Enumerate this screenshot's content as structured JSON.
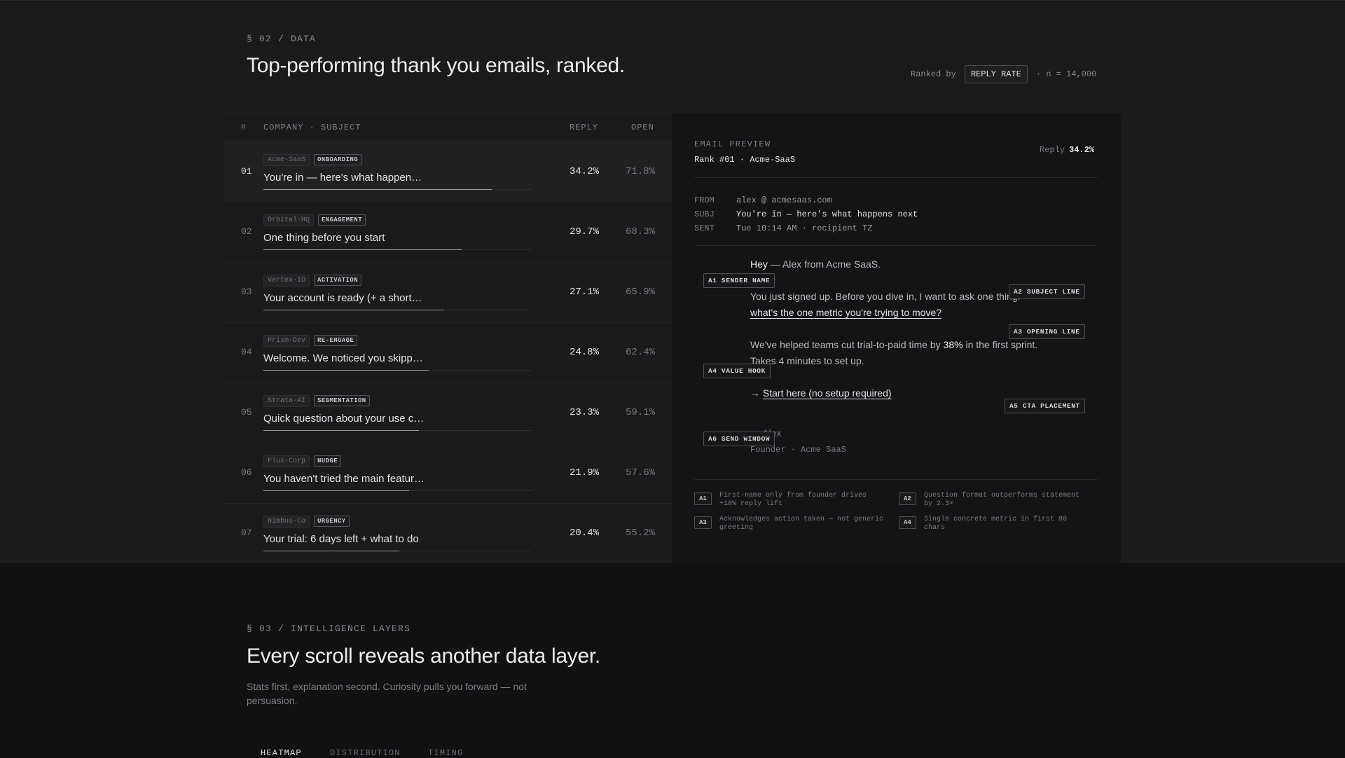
{
  "section02": {
    "eyebrow": "§ 02 / DATA",
    "title": "Top-performing thank you emails, ranked.",
    "ranked_by_label": "Ranked by",
    "ranked_by_value": "REPLY RATE",
    "n_label": "· n = 14,000"
  },
  "table": {
    "headers": {
      "rank": "#",
      "company_subject": "COMPANY · SUBJECT",
      "reply": "REPLY",
      "open": "OPEN"
    },
    "rows": [
      {
        "rank": "01",
        "company": "Acme-SaaS",
        "tag": "ONBOARDING",
        "subject": "You're in — here's what happen…",
        "reply": "34.2%",
        "open": "71.8%",
        "reply_value": 34.2
      },
      {
        "rank": "02",
        "company": "Orbital-HQ",
        "tag": "ENGAGEMENT",
        "subject": "One thing before you start",
        "reply": "29.7%",
        "open": "68.3%",
        "reply_value": 29.7
      },
      {
        "rank": "03",
        "company": "Vertex-IO",
        "tag": "ACTIVATION",
        "subject": "Your account is ready (+ a short…",
        "reply": "27.1%",
        "open": "65.9%",
        "reply_value": 27.1
      },
      {
        "rank": "04",
        "company": "Prism-Dev",
        "tag": "RE-ENGAGE",
        "subject": "Welcome. We noticed you skipp…",
        "reply": "24.8%",
        "open": "62.4%",
        "reply_value": 24.8
      },
      {
        "rank": "05",
        "company": "Strata-AI",
        "tag": "SEGMENTATION",
        "subject": "Quick question about your use c…",
        "reply": "23.3%",
        "open": "59.1%",
        "reply_value": 23.3
      },
      {
        "rank": "06",
        "company": "Flux-Corp",
        "tag": "NUDGE",
        "subject": "You haven't tried the main featur…",
        "reply": "21.9%",
        "open": "57.6%",
        "reply_value": 21.9
      },
      {
        "rank": "07",
        "company": "Nimbus-Co",
        "tag": "URGENCY",
        "subject": "Your trial: 6 days left + what to do",
        "reply": "20.4%",
        "open": "55.2%",
        "reply_value": 20.4
      }
    ]
  },
  "preview": {
    "label": "EMAIL PREVIEW",
    "rank_line": "Rank #01 · Acme-SaaS",
    "reply_label": "Reply",
    "reply_value": "34.2%",
    "from_label": "FROM",
    "from_value": "alex @ acmesaas.com",
    "subj_label": "SUBJ",
    "subj_value": "You're in — here's what happens next",
    "sent_label": "SENT",
    "sent_value": "Tue 10:14 AM · recipient TZ",
    "greeting_hey": "Hey",
    "greeting_rest": " — Alex from Acme SaaS.",
    "para1": "You just signed up. Before you dive in, I want to ask one thing:",
    "question_link": "what's the one metric you're trying to move?",
    "para2_start": "We've helped teams cut trial-to-paid time by ",
    "para2_highlight": "38%",
    "para2_end": " in the first sprint.",
    "para3": "Takes 4 minutes to set up.",
    "cta_arrow": "→ ",
    "cta_link": "Start here (no setup required)",
    "signoff": "— Alex",
    "signature": "Founder · Acme SaaS",
    "annotations": {
      "a1": "A1 SENDER NAME",
      "a2": "A2 SUBJECT LINE",
      "a3": "A3 OPENING LINE",
      "a4": "A4 VALUE HOOK",
      "a5": "A5 CTA PLACEMENT",
      "a6": "A6 SEND WINDOW"
    },
    "notes": [
      {
        "badge": "A1",
        "text": "First-name only from founder drives +18% reply lift"
      },
      {
        "badge": "A2",
        "text": "Question format outperforms statement by 2.3×"
      },
      {
        "badge": "A3",
        "text": "Acknowledges action taken — not generic greeting"
      },
      {
        "badge": "A4",
        "text": "Single concrete metric in first 80 chars"
      }
    ]
  },
  "section03": {
    "eyebrow": "§ 03 / INTELLIGENCE LAYERS",
    "title": "Every scroll reveals another data layer.",
    "subtitle": "Stats first, explanation second. Curiosity pulls you forward — not persuasion.",
    "tabs": [
      "HEATMAP",
      "DISTRIBUTION",
      "TIMING"
    ],
    "active_tab": "HEATMAP"
  }
}
